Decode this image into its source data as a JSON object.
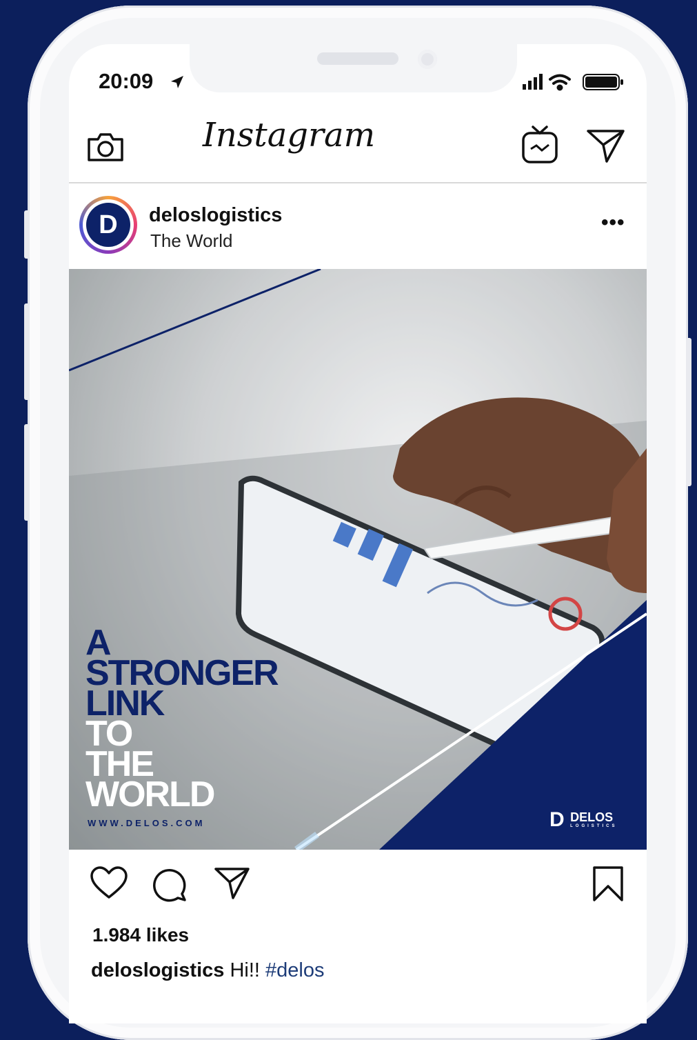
{
  "status_bar": {
    "time": "20:09"
  },
  "header": {
    "app_name": "Instagram"
  },
  "post": {
    "username": "deloslogistics",
    "location": "The World",
    "avatar_letter": "D",
    "more_label": "•••",
    "image": {
      "headline_lines": [
        "A",
        "STRONGER",
        "LINK",
        "TO",
        "THE",
        "WORLD"
      ],
      "url": "WWW.DELOS.COM",
      "brand_name": "DELOS",
      "brand_sub": "LOGISTICS",
      "brand_mark": "D"
    },
    "likes": "1.984 likes",
    "caption_user": "deloslogistics",
    "caption_text": "Hi!!",
    "caption_tag": "#delos"
  },
  "colors": {
    "background": "#0c1f5c",
    "brand_navy": "#0d2268",
    "hashtag": "#1d3c78"
  },
  "icons": [
    "location-arrow-icon",
    "signal-icon",
    "wifi-icon",
    "battery-icon",
    "camera-icon",
    "igtv-icon",
    "direct-send-icon",
    "more-icon",
    "heart-icon",
    "comment-icon",
    "share-icon",
    "bookmark-icon"
  ]
}
